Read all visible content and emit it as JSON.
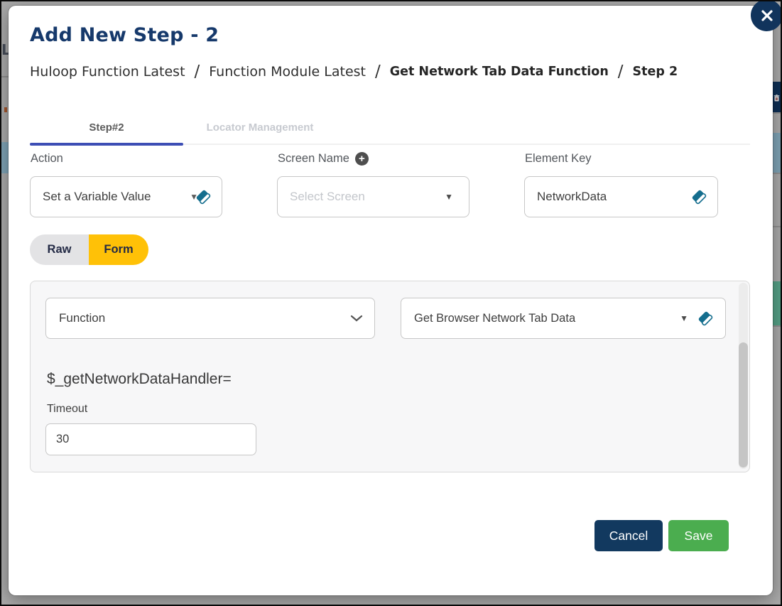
{
  "modal": {
    "title": "Add New Step - 2",
    "breadcrumb": {
      "separator": "/",
      "items": [
        {
          "label": "Huloop Function Latest"
        },
        {
          "label": "Function Module Latest"
        },
        {
          "label": "Get Network Tab Data Function"
        },
        {
          "label": "Step 2"
        }
      ]
    },
    "tabs": [
      {
        "label": "Step#2",
        "active": true
      },
      {
        "label": "Locator Management",
        "active": false
      }
    ],
    "fields": {
      "action_label": "Action",
      "action_value": "Set a Variable Value",
      "screen_name_label": "Screen Name",
      "screen_name_placeholder": "Select Screen",
      "element_key_label": "Element Key",
      "element_key_value": "NetworkData"
    },
    "view_toggle": {
      "raw": "Raw",
      "form": "Form",
      "selected": "Form"
    },
    "form_panel": {
      "type_value": "Function",
      "function_value": "Get Browser Network Tab Data",
      "expression": "$_getNetworkDataHandler=",
      "timeout_label": "Timeout",
      "timeout_value": "30"
    },
    "footer": {
      "cancel": "Cancel",
      "save": "Save"
    }
  },
  "icons": {
    "caret_down": "▼",
    "plus": "+"
  },
  "background": {
    "left_text": "L"
  },
  "colors": {
    "title_navy": "#16396b",
    "tab_underline_indigo": "#3d4eb5",
    "toggle_amber": "#ffc107",
    "eraser_teal": "#156e8e",
    "cancel_navy": "#12395f",
    "save_green": "#4bad4f",
    "close_navy": "#11345c",
    "overlay_gray": "#a9a9a9"
  }
}
